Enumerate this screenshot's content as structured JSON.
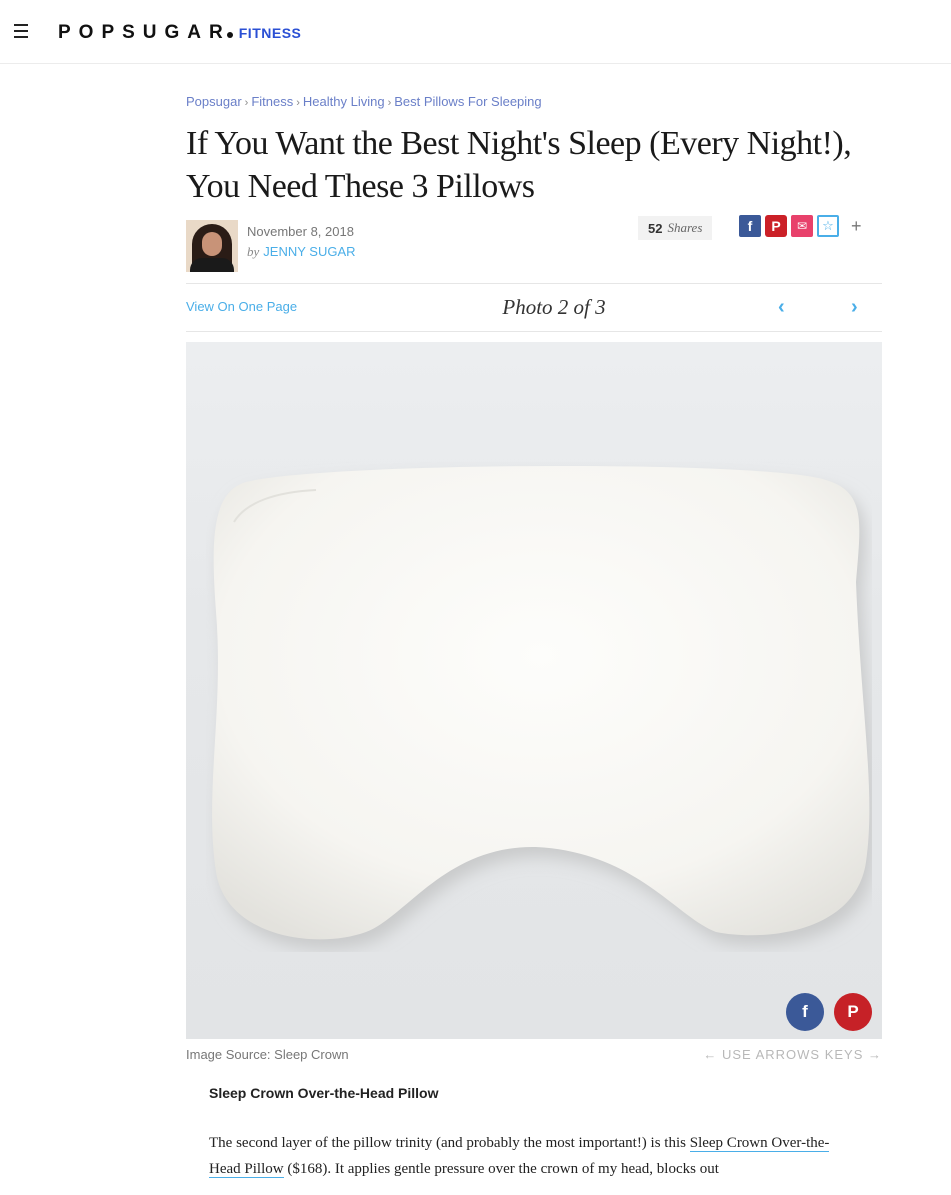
{
  "header": {
    "logo_text": "POPSUGAR",
    "section": "FITNESS",
    "menu_icon": "hamburger-menu-icon"
  },
  "breadcrumb": [
    "Popsugar",
    "Fitness",
    "Healthy Living",
    "Best Pillows For Sleeping"
  ],
  "article": {
    "title": "If You Want the Best Night's Sleep (Every Night!), You Need These 3 Pillows",
    "date": "November 8, 2018",
    "by": "by",
    "author": "JENNY SUGAR",
    "shares_count": "52",
    "shares_label": "Shares"
  },
  "social": {
    "facebook": "f",
    "pinterest": "P",
    "email": "✉",
    "favorite": "☆",
    "more": "+"
  },
  "gallery": {
    "view_one_page": "View On One Page",
    "photo_label": "Photo 2 of 3",
    "prev": "‹",
    "next": "›",
    "image_source": "Image Source: Sleep Crown",
    "arrow_hint": "← USE ARROWS KEYS →",
    "overlay_facebook": "f",
    "overlay_pinterest": "P"
  },
  "item": {
    "title": "Sleep Crown Over-the-Head Pillow",
    "body_start": "The second layer of the pillow trinity (and probably the most important!) is this ",
    "body_link": "Sleep Crown Over-the-Head Pillow",
    "body_rest": " ($168). It applies gentle pressure over the crown of my head, blocks out"
  },
  "colors": {
    "accent_blue": "#4aaee8",
    "section_blue": "#2a4fd4",
    "facebook": "#3b5998",
    "pinterest": "#cb2027"
  }
}
